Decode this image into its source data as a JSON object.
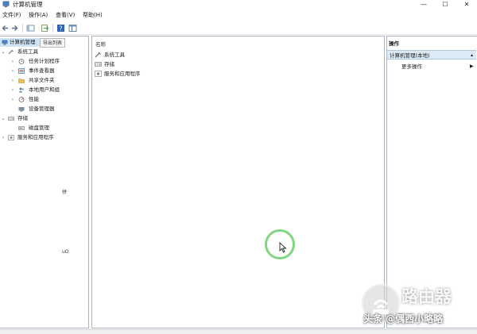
{
  "window": {
    "title": "计算机管理",
    "controls": [
      "—",
      "☐",
      "✕"
    ]
  },
  "menu": [
    "文件(F)",
    "操作(A)",
    "查看(V)",
    "帮助(H)"
  ],
  "toolbar_tooltip": "导出列表",
  "tree": {
    "root": "计算机管理",
    "items": [
      {
        "label": "系统工具",
        "arrow": "⌄"
      },
      {
        "label": "任务计划程序",
        "arrow": "›"
      },
      {
        "label": "事件查看器",
        "arrow": "›"
      },
      {
        "label": "共享文件夹",
        "arrow": "›"
      },
      {
        "label": "本地用户和组",
        "arrow": "›"
      },
      {
        "label": "性能",
        "arrow": "›"
      },
      {
        "label": "设备管理器",
        "arrow": ""
      },
      {
        "label": "存储",
        "arrow": "⌄"
      },
      {
        "label": "磁盘管理",
        "arrow": ""
      },
      {
        "label": "服务和应用程序",
        "arrow": "›"
      }
    ]
  },
  "center": {
    "column_header": "名称",
    "rows": [
      "系统工具",
      "存储",
      "服务和应用程序"
    ]
  },
  "actions": {
    "header": "操作",
    "group": "计算机管理(本地)",
    "more": "更多操作"
  },
  "fragments": [
    "拼",
    "uO"
  ],
  "watermark": {
    "logo_text": "路由器",
    "credit": "头条 @偶西小略略"
  },
  "colors": {
    "selection": "#cde4f7",
    "actions_group": "#dce9f6",
    "cursor_ring": "#7fd67f"
  }
}
